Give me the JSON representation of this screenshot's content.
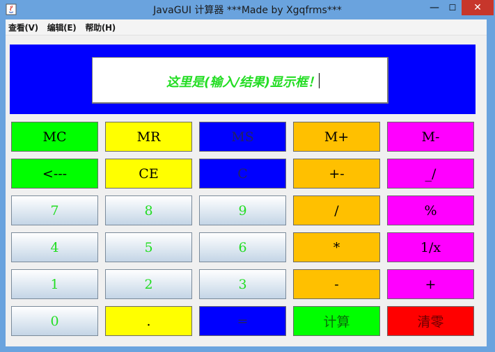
{
  "window": {
    "title": "JavaGUI 计算器 ***Made by Xgqfrms***",
    "minimize_glyph": "—",
    "maximize_glyph": "☐",
    "close_glyph": "✕"
  },
  "menubar": {
    "items": [
      {
        "label": "查看(V)"
      },
      {
        "label": "编辑(E)"
      },
      {
        "label": "帮助(H)"
      }
    ]
  },
  "display": {
    "text": "这里是(输入/结果)显示框！"
  },
  "colors": {
    "green": "#00ff00",
    "yellow": "#ffff00",
    "blue": "#0000ff",
    "orange": "#ffc000",
    "magenta": "#ff00ff",
    "red": "#ff0000",
    "display_text": "#22dd22",
    "titlebar": "#6aa3de"
  },
  "keypad": {
    "rows": [
      [
        {
          "label": "MC",
          "color": "green"
        },
        {
          "label": "MR",
          "color": "yellow"
        },
        {
          "label": "MS",
          "color": "blue"
        },
        {
          "label": "M+",
          "color": "orange"
        },
        {
          "label": "M-",
          "color": "magenta"
        }
      ],
      [
        {
          "label": "<---",
          "color": "green"
        },
        {
          "label": "CE",
          "color": "yellow"
        },
        {
          "label": "C",
          "color": "blue"
        },
        {
          "label": "+-",
          "color": "orange"
        },
        {
          "label": "_/",
          "color": "magenta"
        }
      ],
      [
        {
          "label": "7",
          "color": "num"
        },
        {
          "label": "8",
          "color": "num"
        },
        {
          "label": "9",
          "color": "num"
        },
        {
          "label": "/",
          "color": "orange"
        },
        {
          "label": "%",
          "color": "magenta"
        }
      ],
      [
        {
          "label": "4",
          "color": "num"
        },
        {
          "label": "5",
          "color": "num"
        },
        {
          "label": "6",
          "color": "num"
        },
        {
          "label": "*",
          "color": "orange"
        },
        {
          "label": "1/x",
          "color": "magenta"
        }
      ],
      [
        {
          "label": "1",
          "color": "num"
        },
        {
          "label": "2",
          "color": "num"
        },
        {
          "label": "3",
          "color": "num"
        },
        {
          "label": "-",
          "color": "orange"
        },
        {
          "label": "+",
          "color": "magenta"
        }
      ],
      [
        {
          "label": "0",
          "color": "num"
        },
        {
          "label": ".",
          "color": "yellow"
        },
        {
          "label": "=",
          "color": "blue"
        },
        {
          "label": "计算",
          "color": "green-cjk"
        },
        {
          "label": "清零",
          "color": "red-cjk"
        }
      ]
    ]
  }
}
